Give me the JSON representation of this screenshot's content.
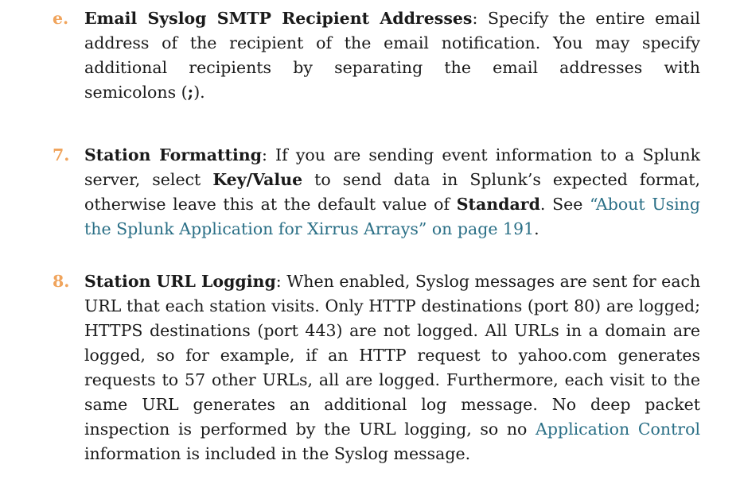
{
  "doc": {
    "item_e": {
      "marker": "e.",
      "term": "Email Syslog SMTP Recipient Addresses",
      "text_1": ": Specify the entire email",
      "line_2": "address of the recipient of the email notification. You may specify",
      "line_3": "additional recipients by separating the email addresses with",
      "line_4_pre": "semicolons (",
      "line_4_bold": ";",
      "line_4_post": ")."
    },
    "item_7": {
      "marker": "7.",
      "term": "Station Formatting",
      "text_1": ": If you are sending event information to a Splunk",
      "line_2_pre": "server, select ",
      "line_2_bold": "Key/Value",
      "line_2_post": " to send data in Splunk’s expected format,",
      "line_3_pre": "otherwise leave this at the default value of ",
      "line_3_bold": "Standard",
      "line_3_post": ". See ",
      "line_3_link": "“About Using",
      "line_4_link": "the Splunk Application for Xirrus Arrays” on page 191",
      "line_4_post": "."
    },
    "item_8": {
      "marker": "8.",
      "term": "Station URL Logging",
      "text_1": ": When enabled, Syslog messages are sent for each",
      "line_2": "URL that each station visits. Only HTTP destinations (port 80) are logged;",
      "line_3": "HTTPS destinations (port 443) are not logged. All URLs in a domain are",
      "line_4": "logged, so for example, if an HTTP request to yahoo.com generates",
      "line_5": "requests to 57 other URLs, all are logged. Furthermore, each visit to the",
      "line_6": "same URL generates an additional log message. No deep packet",
      "line_7_pre": "inspection is performed by the URL logging, so no ",
      "line_7_link": "Application Control",
      "line_8": "information is included in the Syslog message."
    },
    "colors": {
      "marker": "#f0a45c",
      "link": "#2a6f86",
      "text": "#1a1a1a"
    }
  }
}
